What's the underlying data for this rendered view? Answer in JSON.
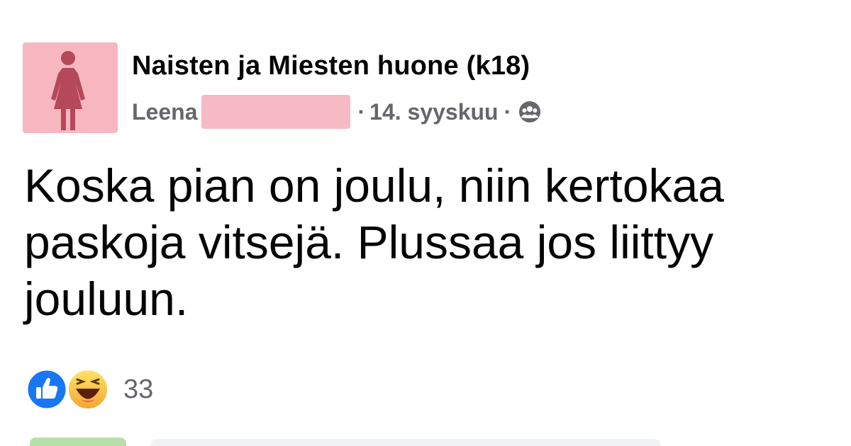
{
  "group": {
    "name": "Naisten ja Miesten huone (k18)",
    "avatar_icon": "woman-figure-icon",
    "avatar_color": "#f6b7c0"
  },
  "meta": {
    "author": "Leena",
    "separator": "·",
    "date": "14. syyskuu",
    "privacy_icon": "group-members-icon"
  },
  "post": {
    "text": "Koska pian on joulu, niin kertokaa\npaskoja vitsejä. Plussaa jos liittyy\njouluun."
  },
  "reactions": {
    "icons": [
      "like-icon",
      "haha-icon"
    ],
    "count": "33"
  },
  "colors": {
    "like_blue": "#1877f2",
    "haha_yellow": "#f7b928",
    "meta_gray": "#65676b",
    "redaction_pink": "#f7b9c4"
  }
}
